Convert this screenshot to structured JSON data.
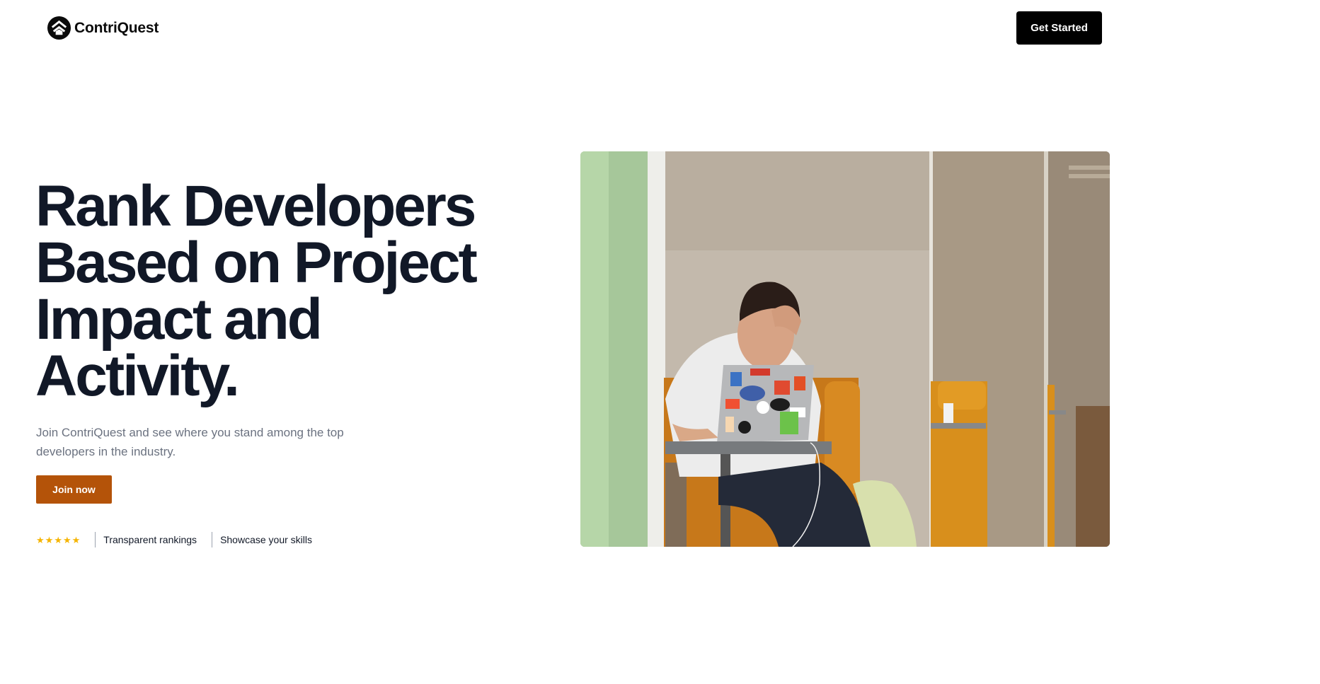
{
  "brand": {
    "name": "ContriQuest",
    "logo_icon": "chevron-up-shield-icon"
  },
  "header": {
    "cta_label": "Get Started"
  },
  "hero": {
    "title_lines": [
      "Rank Developers",
      "Based on Project",
      "Impact and",
      "Activity."
    ],
    "subtitle": "Join ContriQuest and see where you stand among the top developers in the industry.",
    "join_label": "Join now"
  },
  "features": {
    "rating": 5,
    "items": [
      "Transparent rankings",
      "Showcase your skills"
    ]
  },
  "colors": {
    "accent": "#b45309",
    "star": "#f5b400",
    "heading": "#111827",
    "muted": "#6b7280"
  }
}
